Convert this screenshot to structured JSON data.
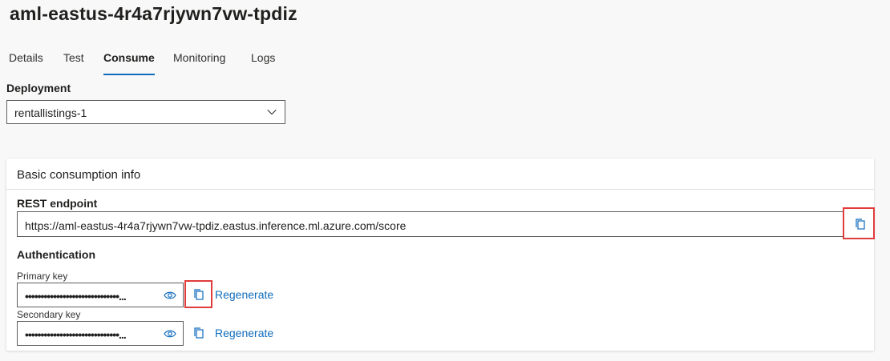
{
  "page": {
    "title": "aml-eastus-4r4a7rjywn7vw-tpdiz"
  },
  "tabs": [
    {
      "label": "Details"
    },
    {
      "label": "Test"
    },
    {
      "label": "Consume"
    },
    {
      "label": "Monitoring"
    },
    {
      "label": "Logs"
    }
  ],
  "active_tab": "Consume",
  "deployment": {
    "label": "Deployment",
    "selected": "rentallistings-1"
  },
  "card": {
    "title": "Basic consumption info",
    "rest_endpoint": {
      "label": "REST endpoint",
      "value": "https://aml-eastus-4r4a7rjywn7vw-tpdiz.eastus.inference.ml.azure.com/score"
    },
    "authentication": {
      "label": "Authentication",
      "primary": {
        "label": "Primary key",
        "masked": "••••••••••••••••••••••••••••••..."
      },
      "secondary": {
        "label": "Secondary key",
        "masked": "••••••••••••••••••••••••••••••..."
      },
      "regenerate_label": "Regenerate"
    }
  },
  "colors": {
    "accent": "#0f6cbd",
    "highlight": "#e03c3c"
  },
  "icons": [
    "chevron-down-icon",
    "copy-icon",
    "eye-icon"
  ]
}
